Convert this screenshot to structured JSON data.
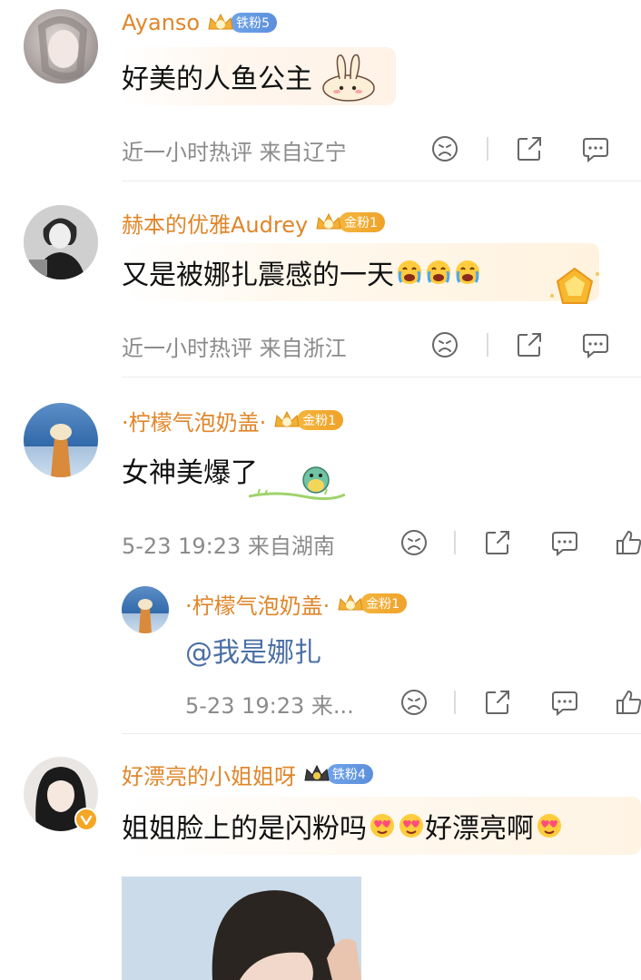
{
  "comments": [
    {
      "username": "Ayanso",
      "badge": {
        "level": "4",
        "label": "铁粉5",
        "tier": "iron"
      },
      "text": "好美的人鱼公主",
      "meta": "近一小时热评 来自辽宁"
    },
    {
      "username": "赫本的优雅Audrey",
      "badge": {
        "level": "7",
        "label": "金粉1",
        "tier": "gold"
      },
      "text": "又是被娜扎震感的一天",
      "meta": "近一小时热评 来自浙江"
    },
    {
      "username": "·柠檬气泡奶盖·",
      "badge": {
        "level": "6",
        "label": "金粉1",
        "tier": "gold"
      },
      "text": "女神美爆了",
      "meta": "5-23 19:23 来自湖南",
      "reply": {
        "username": "·柠檬气泡奶盖·",
        "badge": {
          "level": "6",
          "label": "金粉1",
          "tier": "gold"
        },
        "text": "@我是娜扎",
        "meta": "5-23 19:23 来..."
      }
    },
    {
      "username": "好漂亮的小姐姐呀",
      "badge": {
        "level": "",
        "label": "铁粉4",
        "tier": "iron"
      },
      "text_part1": "姐姐脸上的是闪粉吗",
      "text_part2": "好漂亮啊"
    }
  ],
  "icons": [
    "dislike-icon",
    "share-icon",
    "comment-icon",
    "like-icon",
    "verified-icon",
    "crown-icon"
  ],
  "colors": {
    "username": "#e0862a",
    "meta": "#8b8b8b",
    "mention": "#4a6fa5",
    "iron_badge": "#5b8fdc",
    "gold_badge": "#f0a22a"
  }
}
